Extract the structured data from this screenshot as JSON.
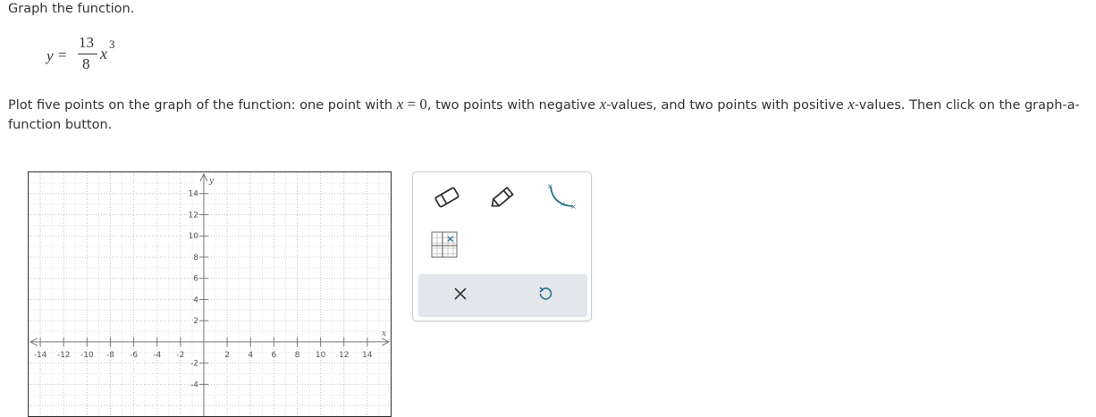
{
  "prompt": "Graph the function.",
  "equation": {
    "lhs": "y",
    "equals": "=",
    "numerator": "13",
    "denominator": "8",
    "variable": "x",
    "exponent": "3"
  },
  "instruction": {
    "part1": "Plot five points on the graph of the function: one point with ",
    "cond1_var": "x",
    "cond1_rest": " = 0",
    "part2": ", two points with negative ",
    "neg_var": "x",
    "part3": "-values, and two points with positive ",
    "pos_var": "x",
    "part4": "-values. Then click on the graph-a-function button."
  },
  "graph": {
    "x_axis_label": "x",
    "y_axis_label": "y",
    "x_ticks": [
      "-14",
      "-12",
      "-10",
      "-8",
      "-6",
      "-4",
      "-2",
      "2",
      "4",
      "6",
      "8",
      "10",
      "12",
      "14"
    ],
    "y_ticks": [
      "14",
      "12",
      "10",
      "8",
      "6",
      "4",
      "2",
      "-2",
      "-4"
    ],
    "x_tick_values": [
      -14,
      -12,
      -10,
      -8,
      -6,
      -4,
      -2,
      2,
      4,
      6,
      8,
      10,
      12,
      14
    ],
    "y_tick_values": [
      14,
      12,
      10,
      8,
      6,
      4,
      2,
      -2,
      -4
    ],
    "x_range": [
      -15,
      16
    ],
    "y_range": [
      -7,
      16
    ],
    "grid": true
  },
  "toolbox": {
    "tools": [
      {
        "icon": "eraser-icon"
      },
      {
        "icon": "pencil-icon"
      },
      {
        "icon": "graph-a-function-icon"
      },
      {
        "icon": "point-on-grid-icon"
      }
    ],
    "actions": [
      {
        "icon": "clear-x-icon"
      },
      {
        "icon": "undo-icon"
      }
    ],
    "accent_color": "#2b6f8a",
    "action_bar_color": "#e3e7eb"
  }
}
